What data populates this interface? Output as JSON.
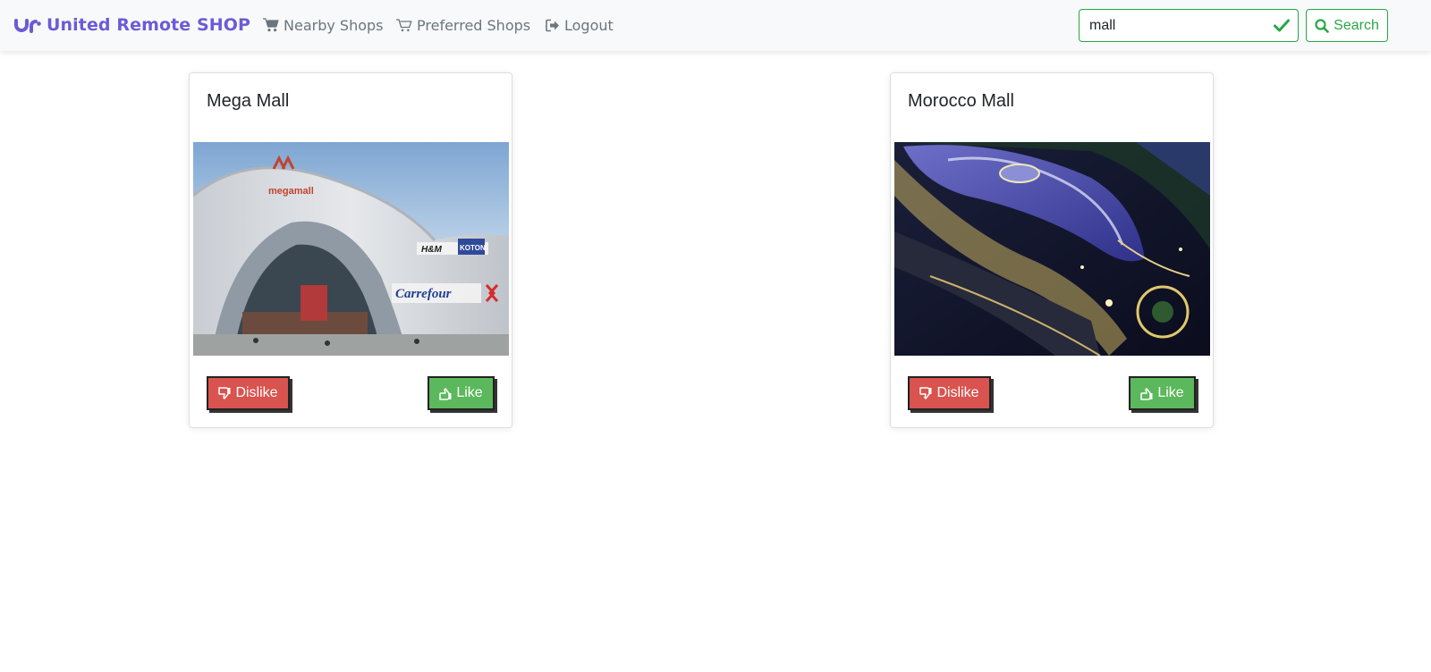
{
  "navbar": {
    "brand": {
      "text": "United Remote SHOP",
      "logo_icon": "brand-logo-icon",
      "color": "#6b5bd6"
    },
    "links": [
      {
        "label": "Nearby Shops",
        "icon": "cart-icon"
      },
      {
        "label": "Preferred Shops",
        "icon": "cart-outline-icon"
      },
      {
        "label": "Logout",
        "icon": "sign-out-icon"
      }
    ],
    "search": {
      "value": "mall",
      "valid_icon": "check-icon",
      "button_label": "Search",
      "button_icon": "search-icon",
      "accent": "#28a745"
    }
  },
  "shops": [
    {
      "name": "Mega Mall",
      "image": "mega-mall-photo",
      "dislike_label": "Dislike",
      "like_label": "Like"
    },
    {
      "name": "Morocco Mall",
      "image": "morocco-mall-aerial-photo",
      "dislike_label": "Dislike",
      "like_label": "Like"
    }
  ],
  "colors": {
    "dislike": "#d9534f",
    "like": "#5cb85c",
    "navbar_bg": "#f8f9fa"
  },
  "image_text": {
    "mega_mall_logo": "megamall",
    "mega_mall_store_1": "H&M",
    "mega_mall_store_2": "Carrefour",
    "mega_mall_store_3": "KOTON"
  }
}
